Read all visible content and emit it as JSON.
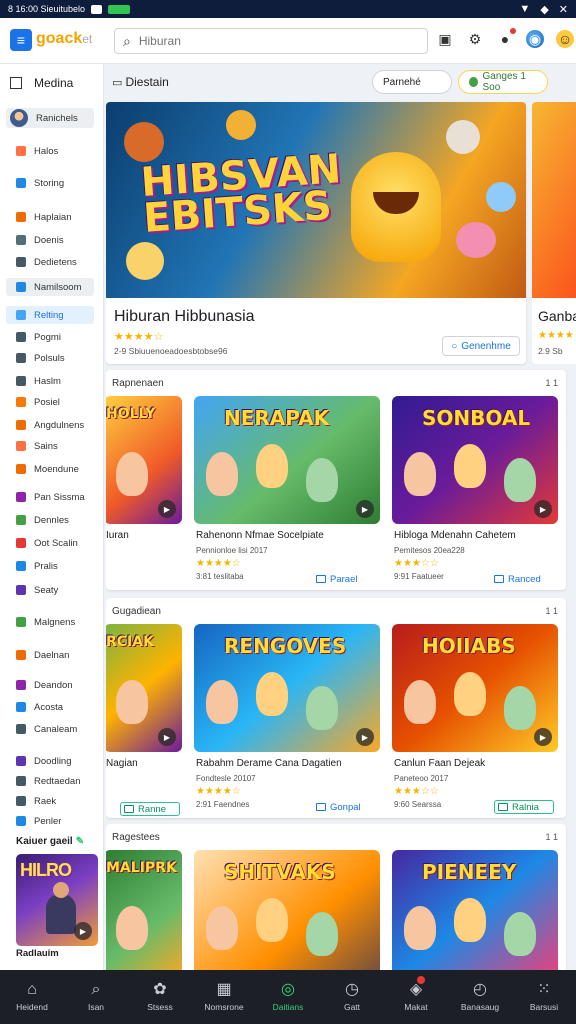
{
  "status_bar": {
    "left_text": "8 16:00 Sieuitubelo",
    "icons": [
      "signal-icon",
      "wifi-icon",
      "close-icon"
    ]
  },
  "topbar": {
    "logo": "goack",
    "logo_tail": "et",
    "search_placeholder": "Hiburan",
    "icons": [
      "cast-icon",
      "bell-icon",
      "notification-icon",
      "avatar-icon",
      "emoji-icon"
    ]
  },
  "sidebar": {
    "heading": "Medina",
    "profile": "Ranichels",
    "items": [
      {
        "label": "Halos",
        "color": "#ff7043"
      },
      {
        "label": "Storing",
        "color": "#1e88e5"
      },
      {
        "label": "Haplaian",
        "color": "#ef6c00"
      },
      {
        "label": "Doenis",
        "color": "#546e7a"
      },
      {
        "label": "Dedietens",
        "color": "#455a64"
      },
      {
        "label": "Namilsoom",
        "color": "#1e88e5"
      },
      {
        "label": "Relting",
        "color": "#42a5f5"
      },
      {
        "label": "Pogmi",
        "color": "#455a64"
      },
      {
        "label": "Polsuls",
        "color": "#455a64"
      },
      {
        "label": "Haslm",
        "color": "#455a64"
      },
      {
        "label": "Posiel",
        "color": "#f57c00"
      },
      {
        "label": "Angdulnens",
        "color": "#ef6c00"
      },
      {
        "label": "Sains",
        "color": "#ff7043"
      },
      {
        "label": "Moendune",
        "color": "#ef6c00"
      },
      {
        "label": "Pan Sissma",
        "color": "#8e24aa"
      },
      {
        "label": "Dennles",
        "color": "#43a047"
      },
      {
        "label": "Oot Scalin",
        "color": "#e53935"
      },
      {
        "label": "Pralis",
        "color": "#1e88e5"
      },
      {
        "label": "Seaty",
        "color": "#5e35b1"
      },
      {
        "label": "Malgnens",
        "color": "#43a047"
      },
      {
        "label": "Daelnan",
        "color": "#ef6c00"
      },
      {
        "label": "Deandon",
        "color": "#8e24aa"
      },
      {
        "label": "Acosta",
        "color": "#1e88e5"
      },
      {
        "label": "Canaleam",
        "color": "#455a64"
      },
      {
        "label": "Doodling",
        "color": "#5e35b1"
      },
      {
        "label": "Redtaedan",
        "color": "#455a64"
      },
      {
        "label": "Raek",
        "color": "#455a64"
      },
      {
        "label": "Penler",
        "color": "#1e88e5"
      }
    ],
    "subheading": "Kaiuer gaeil",
    "thumb_art": "HILRO",
    "thumb_title": "Radlauim"
  },
  "main": {
    "section_label": "Diestain",
    "chip_grey": "Parnehé",
    "chip_yellow": "Ganges 1 Soo",
    "hero": {
      "art_line1": "HIBSVAN",
      "art_line2": "EBITSKS",
      "title": "Hiburan Hibbunasia",
      "stars": "★★★★☆",
      "meta": "2-9 Sbiuuenoeadoesbtobse96",
      "button": "Genenhme"
    },
    "hero_peek": {
      "title": "Ganba",
      "stars": "★★★★",
      "meta": "2.9 Sb"
    },
    "rows": [
      {
        "label": "Rapnenaen",
        "count": "1 1",
        "tiles": [
          {
            "art": "HOLLY",
            "title": "Iuran",
            "sub": "",
            "stars": "",
            "meta": "",
            "button": ""
          },
          {
            "art": "NERAPAK",
            "title": "Rahenonn Nfmae Socelpiate",
            "sub": "Pennionloe lisi 2017",
            "stars": "★★★★☆",
            "meta": "3:81 teslitaba",
            "button": "Parael"
          },
          {
            "art": "SONBOAL",
            "title": "Hibloga Mdenahn Cahetem",
            "sub": "Pemitesos 20ea228",
            "stars": "★★★☆☆",
            "meta": "9:91 Faatueer",
            "button": "Ranced"
          }
        ]
      },
      {
        "label": "Gugadiean",
        "count": "1 1",
        "tiles": [
          {
            "art": "RCIAK",
            "title": "Nagian",
            "sub": "",
            "stars": "",
            "meta": "",
            "button": "Ranne"
          },
          {
            "art": "RENGOVES",
            "title": "Rabahm Derame Cana Dagatien",
            "sub": "Fondtesle 20107",
            "stars": "★★★★☆",
            "meta": "2:91 Faendnes",
            "button": "Gonpal"
          },
          {
            "art": "HOIIABS",
            "title": "Canlun Faan Dejeak",
            "sub": "Paneteoo 2017",
            "stars": "★★★☆☆",
            "meta": "9:60 Searssa",
            "button": "Ralnia"
          }
        ]
      },
      {
        "label": "Ragestees",
        "count": "1 1",
        "tiles": [
          {
            "art": "MALIPRK",
            "title": "",
            "sub": "",
            "stars": "",
            "meta": "",
            "button": ""
          },
          {
            "art": "SHITVAKS",
            "title": "",
            "sub": "",
            "stars": "",
            "meta": "",
            "button": ""
          },
          {
            "art": "PIENEEY",
            "title": "",
            "sub": "",
            "stars": "",
            "meta": "",
            "button": ""
          }
        ]
      }
    ]
  },
  "bottom_nav": [
    {
      "label": "Heidend",
      "icon": "home-icon"
    },
    {
      "label": "Isan",
      "icon": "search-icon"
    },
    {
      "label": "Stsess",
      "icon": "games-icon"
    },
    {
      "label": "Nomsrone",
      "icon": "apps-icon"
    },
    {
      "label": "Daitians",
      "icon": "play-icon",
      "active": true
    },
    {
      "label": "Gatt",
      "icon": "clock-icon"
    },
    {
      "label": "Makat",
      "icon": "bag-icon",
      "badge": true
    },
    {
      "label": "Banasaug",
      "icon": "history-icon"
    },
    {
      "label": "Barsusi",
      "icon": "grid-icon"
    }
  ]
}
